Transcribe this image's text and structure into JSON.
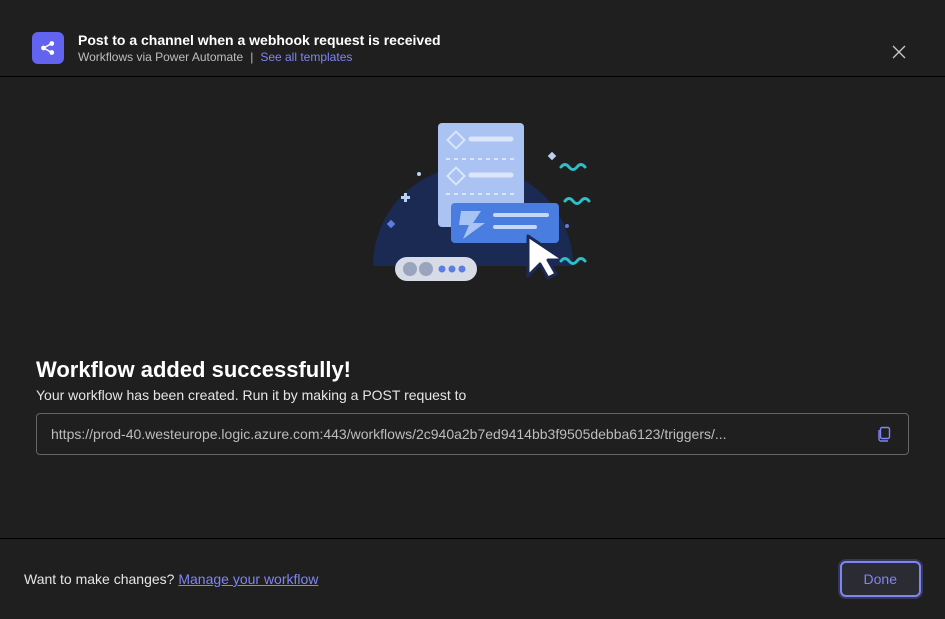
{
  "header": {
    "title": "Post to a channel when a webhook request is received",
    "subtitle": "Workflows via Power Automate",
    "see_all_label": "See all templates"
  },
  "success": {
    "title": "Workflow added successfully!",
    "subtitle": "Your workflow has been created. Run it by making a POST request to",
    "url_display": "https://prod-40.westeurope.logic.azure.com:443/workflows/2c940a2b7ed9414bb3f9505debba6123/triggers/..."
  },
  "footer": {
    "changes_prompt": "Want to make changes?",
    "manage_link_label": "Manage your workflow",
    "done_label": "Done"
  }
}
